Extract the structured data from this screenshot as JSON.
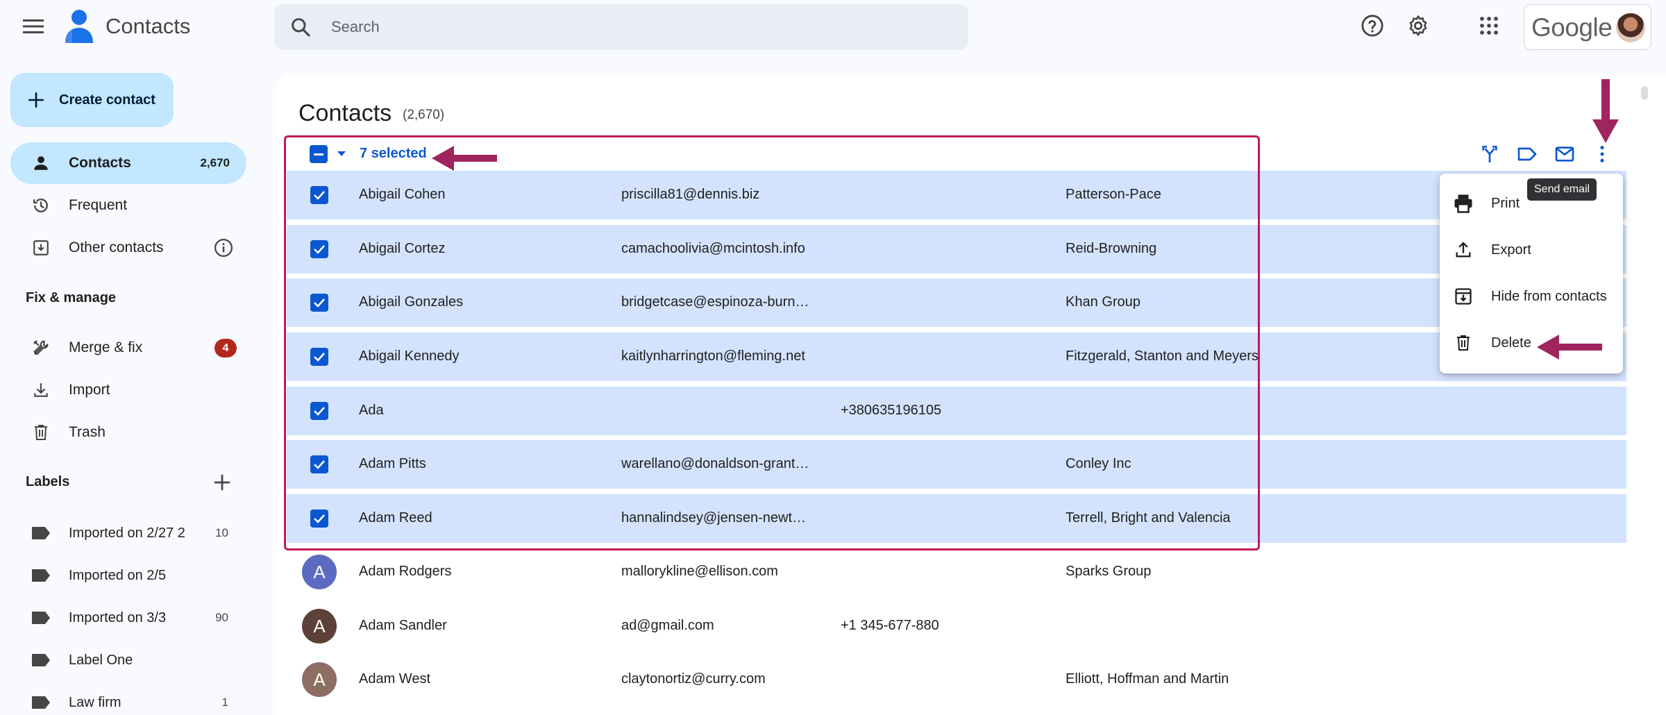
{
  "app": {
    "name": "Contacts",
    "brand": "Google"
  },
  "search": {
    "placeholder": "Search",
    "value": ""
  },
  "sidebar": {
    "create_label": "Create contact",
    "nav": [
      {
        "label": "Contacts",
        "count": "2,670"
      },
      {
        "label": "Frequent"
      },
      {
        "label": "Other contacts"
      }
    ],
    "fix_manage": {
      "heading": "Fix & manage",
      "items": [
        {
          "label": "Merge & fix",
          "badge": "4"
        },
        {
          "label": "Import"
        },
        {
          "label": "Trash"
        }
      ]
    },
    "labels": {
      "heading": "Labels",
      "items": [
        {
          "label": "Imported on 2/27 2",
          "count": "10"
        },
        {
          "label": "Imported on 2/5",
          "count": ""
        },
        {
          "label": "Imported on 3/3",
          "count": "90"
        },
        {
          "label": "Label One",
          "count": ""
        },
        {
          "label": "Law firm",
          "count": "1"
        }
      ]
    }
  },
  "main": {
    "title": "Contacts",
    "total": "(2,670)",
    "selection": {
      "text": "7 selected"
    },
    "rows": [
      {
        "initial": "",
        "name": "Abigail Cohen",
        "email": "priscilla81@dennis.biz",
        "phone": "",
        "company": "Patterson-Pace",
        "selected": true
      },
      {
        "initial": "",
        "name": "Abigail Cortez",
        "email": "camachoolivia@mcintosh.info",
        "phone": "",
        "company": "Reid-Browning",
        "selected": true
      },
      {
        "initial": "",
        "name": "Abigail Gonzales",
        "email": "bridgetcase@espinoza-burn…",
        "phone": "",
        "company": "Khan Group",
        "selected": true
      },
      {
        "initial": "",
        "name": "Abigail Kennedy",
        "email": "kaitlynharrington@fleming.net",
        "phone": "",
        "company": "Fitzgerald, Stanton and Meyers",
        "selected": true
      },
      {
        "initial": "",
        "name": "Ada",
        "email": "",
        "phone": "+380635196105",
        "company": "",
        "selected": true
      },
      {
        "initial": "",
        "name": "Adam Pitts",
        "email": "warellano@donaldson-grant…",
        "phone": "",
        "company": "Conley Inc",
        "selected": true
      },
      {
        "initial": "",
        "name": "Adam Reed",
        "email": "hannalindsey@jensen-newt…",
        "phone": "",
        "company": "Terrell, Bright and Valencia",
        "selected": true
      },
      {
        "initial": "A",
        "avatar_color": "#5c6bc0",
        "name": "Adam Rodgers",
        "email": "mallorykline@ellison.com",
        "phone": "",
        "company": "Sparks Group",
        "selected": false
      },
      {
        "initial": "A",
        "avatar_color": "#5d4037",
        "name": "Adam Sandler",
        "email": "ad@gmail.com",
        "phone": "+1 345-677-880",
        "company": "",
        "selected": false
      },
      {
        "initial": "A",
        "avatar_color": "#8d6e63",
        "name": "Adam West",
        "email": "claytonortiz@curry.com",
        "phone": "",
        "company": "Elliott, Hoffman and Martin",
        "selected": false
      }
    ]
  },
  "more_menu": {
    "items": [
      {
        "label": "Print",
        "icon": "print-icon"
      },
      {
        "label": "Export",
        "icon": "export-icon"
      },
      {
        "label": "Hide from contacts",
        "icon": "archive-icon"
      },
      {
        "label": "Delete",
        "icon": "trash-icon"
      }
    ]
  },
  "tooltip": {
    "text": "Send email"
  },
  "colors": {
    "accent": "#0b57d0",
    "selected_row": "#d3e3fd",
    "nav_active": "#c2e7ff",
    "annotation": "#a0245e",
    "highlight_border": "#c2185b",
    "badge": "#b3261e"
  }
}
